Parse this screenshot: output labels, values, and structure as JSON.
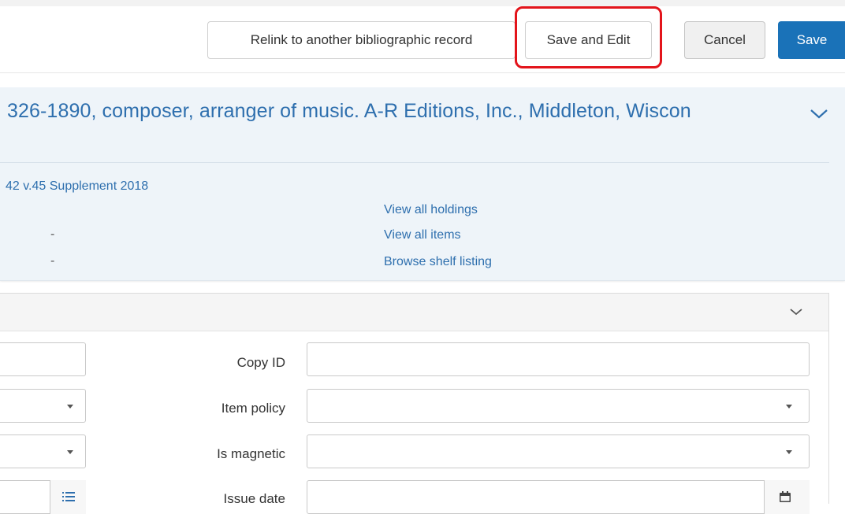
{
  "toolbar": {
    "relink_label": "Relink to another bibliographic record",
    "save_edit_label": "Save and Edit",
    "cancel_label": "Cancel",
    "save_label": "Save",
    "highlight_color": "#e3141b",
    "save_color": "#1a72b8"
  },
  "summary": {
    "title": "326-1890, composer, arranger of music. A-R Editions, Inc., Middleton, Wiscon",
    "subtitle": "42 v.45 Supplement 2018",
    "dash_1": "-",
    "dash_2": "-",
    "links": [
      "View all holdings",
      "View all items",
      "Browse shelf listing"
    ],
    "expand_icon": "chevron-down-icon"
  },
  "form": {
    "fields": [
      {
        "label": "Copy ID",
        "value": "",
        "type": "text"
      },
      {
        "label": "Item policy",
        "value": "",
        "type": "select"
      },
      {
        "label": "Is magnetic",
        "value": "",
        "type": "select"
      },
      {
        "label": "Issue date",
        "value": "",
        "type": "date"
      }
    ],
    "left_fields": [
      {
        "value": "",
        "type": "text"
      },
      {
        "value": "",
        "type": "select"
      },
      {
        "value": "",
        "type": "select"
      },
      {
        "value": "",
        "type": "list"
      }
    ],
    "collapse_icon": "chevron-down-icon",
    "list_icon": "list-icon",
    "calendar_icon": "calendar-icon"
  }
}
